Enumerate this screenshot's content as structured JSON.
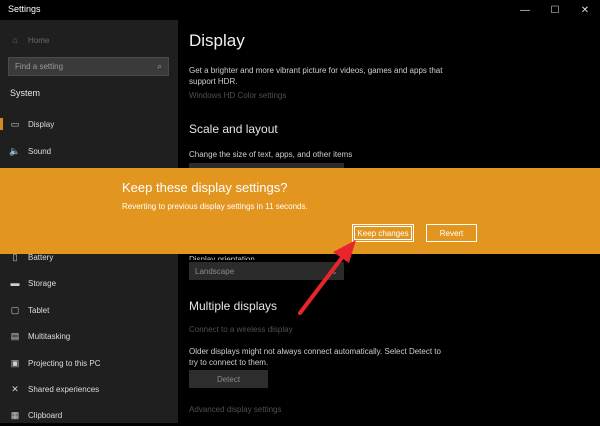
{
  "window": {
    "title": "Settings",
    "minimize_glyph": "—",
    "maximize_glyph": "☐",
    "close_glyph": "✕"
  },
  "sidebar": {
    "home_label": "Home",
    "search_placeholder": "Find a setting",
    "section_label": "System",
    "items": [
      {
        "label": "Display",
        "icon": "display-icon",
        "glyph": "▭"
      },
      {
        "label": "Sound",
        "icon": "sound-icon",
        "glyph": "🔈"
      },
      {
        "label": "Battery",
        "icon": "battery-icon",
        "glyph": "▯"
      },
      {
        "label": "Storage",
        "icon": "storage-icon",
        "glyph": "▬"
      },
      {
        "label": "Tablet",
        "icon": "tablet-icon",
        "glyph": "▢"
      },
      {
        "label": "Multitasking",
        "icon": "multitasking-icon",
        "glyph": "▤"
      },
      {
        "label": "Projecting to this PC",
        "icon": "projecting-icon",
        "glyph": "▣"
      },
      {
        "label": "Shared experiences",
        "icon": "shared-experiences-icon",
        "glyph": "✕"
      },
      {
        "label": "Clipboard",
        "icon": "clipboard-icon",
        "glyph": "▦"
      }
    ]
  },
  "main": {
    "page_title": "Display",
    "hdr_text_line1": "Get a brighter and more vibrant picture for videos, games and apps that",
    "hdr_text_line2": "support HDR.",
    "hdr_link": "Windows HD Color settings",
    "scale_heading": "Scale and layout",
    "scale_text": "Change the size of text, apps, and other items",
    "orientation_label": "Display orientation",
    "orientation_value": "Landscape",
    "multiple_heading": "Multiple displays",
    "wireless_link": "Connect to a wireless display",
    "detect_text_line1": "Older displays might not always connect automatically. Select Detect to",
    "detect_text_line2": "try to connect to them.",
    "detect_button": "Detect",
    "advanced_link": "Advanced display settings"
  },
  "dialog": {
    "title": "Keep these display settings?",
    "message": "Reverting to previous display settings in 11 seconds.",
    "keep_button": "Keep changes",
    "revert_button": "Revert"
  },
  "colors": {
    "dialog_bg": "#e3961f",
    "accent": "#d28a1d",
    "arrow": "#e8252a"
  }
}
